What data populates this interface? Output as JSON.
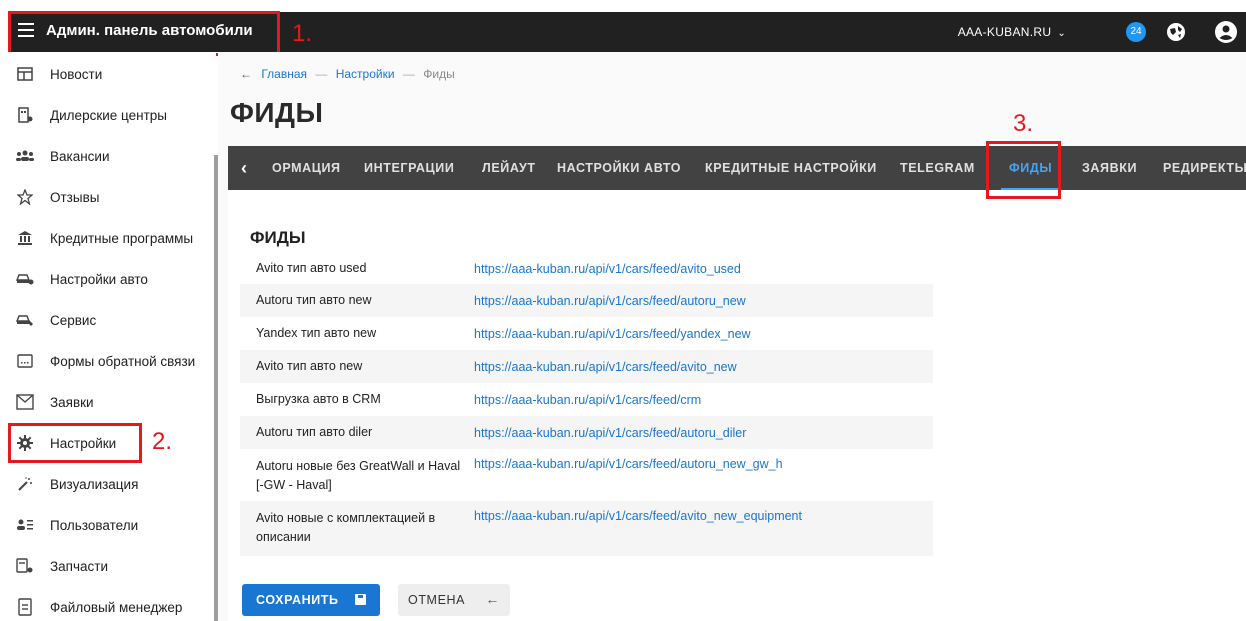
{
  "header": {
    "title": "Админ. панель автомобили",
    "site": "AAA-KUBAN.RU",
    "notifications": "24"
  },
  "annotations": {
    "one": "1.",
    "two": "2.",
    "three": "3."
  },
  "sidebar": {
    "items": [
      {
        "label": "Новости",
        "icon": "newspaper-icon"
      },
      {
        "label": "Дилерские центры",
        "icon": "dealer-icon"
      },
      {
        "label": "Вакансии",
        "icon": "people-icon"
      },
      {
        "label": "Отзывы",
        "icon": "star-icon"
      },
      {
        "label": "Кредитные программы",
        "icon": "bank-icon"
      },
      {
        "label": "Настройки авто",
        "icon": "car-settings-icon"
      },
      {
        "label": "Сервис",
        "icon": "car-service-icon"
      },
      {
        "label": "Формы обратной связи",
        "icon": "form-icon"
      },
      {
        "label": "Заявки",
        "icon": "mail-icon"
      },
      {
        "label": "Настройки",
        "icon": "gear-icon"
      },
      {
        "label": "Визуализация",
        "icon": "magic-wand-icon"
      },
      {
        "label": "Пользователи",
        "icon": "users-list-icon"
      },
      {
        "label": "Запчасти",
        "icon": "parts-icon"
      },
      {
        "label": "Файловый менеджер",
        "icon": "file-icon"
      }
    ]
  },
  "breadcrumb": {
    "home": "Главная",
    "settings": "Настройки",
    "current": "Фиды",
    "separator": "—"
  },
  "page": {
    "title": "ФИДЫ"
  },
  "tabs": [
    {
      "label": "ОРМАЦИЯ"
    },
    {
      "label": "ИНТЕГРАЦИИ"
    },
    {
      "label": "ЛЕЙАУТ"
    },
    {
      "label": "НАСТРОЙКИ АВТО"
    },
    {
      "label": "КРЕДИТНЫЕ НАСТРОЙКИ"
    },
    {
      "label": "TELEGRAM"
    },
    {
      "label": "ФИДЫ"
    },
    {
      "label": "ЗАЯВКИ"
    },
    {
      "label": "РЕДИРЕКТЫ"
    }
  ],
  "feeds": {
    "title": "ФИДЫ",
    "rows": [
      {
        "label": "Avito тип авто used",
        "url": "https://aaa-kuban.ru/api/v1/cars/feed/avito_used"
      },
      {
        "label": "Autoru тип авто new",
        "url": "https://aaa-kuban.ru/api/v1/cars/feed/autoru_new"
      },
      {
        "label": "Yandex тип авто new",
        "url": "https://aaa-kuban.ru/api/v1/cars/feed/yandex_new"
      },
      {
        "label": "Avito тип авто new",
        "url": "https://aaa-kuban.ru/api/v1/cars/feed/avito_new"
      },
      {
        "label": "Выгрузка авто в CRM",
        "url": "https://aaa-kuban.ru/api/v1/cars/feed/crm"
      },
      {
        "label": "Autoru тип авто diler",
        "url": "https://aaa-kuban.ru/api/v1/cars/feed/autoru_diler"
      },
      {
        "label": "Autoru новые без GreatWall и Haval [-GW - Haval]",
        "url": "https://aaa-kuban.ru/api/v1/cars/feed/autoru_new_gw_h"
      },
      {
        "label": "Avito новые с комплектацией в описании",
        "url": "https://aaa-kuban.ru/api/v1/cars/feed/avito_new_equipment"
      }
    ]
  },
  "actions": {
    "save": "СОХРАНИТЬ",
    "cancel": "ОТМЕНА"
  },
  "colors": {
    "accent": "#1976d2",
    "topbar": "#212121",
    "tabs": "#424242",
    "active_tab": "#42a5f5",
    "annotation": "#e3191b"
  }
}
